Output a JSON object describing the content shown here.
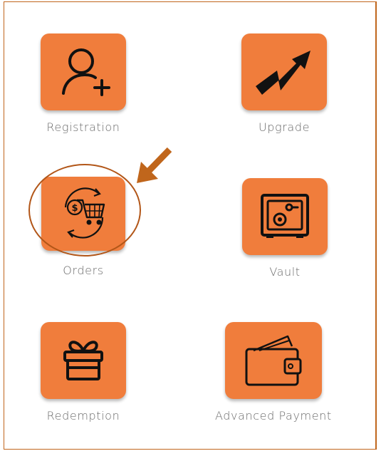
{
  "colors": {
    "accent": "#f07d3c",
    "annotation": "#c0661c",
    "label": "#6a6a6a"
  },
  "tiles": [
    {
      "id": "registration",
      "label": "Registration",
      "icon": "user-add-icon"
    },
    {
      "id": "upgrade",
      "label": "Upgrade",
      "icon": "trend-arrow-icon"
    },
    {
      "id": "orders",
      "label": "Orders",
      "icon": "cart-cycle-icon",
      "highlighted": true
    },
    {
      "id": "vault",
      "label": "Vault",
      "icon": "safe-icon"
    },
    {
      "id": "redemption",
      "label": "Redemption",
      "icon": "gift-icon"
    },
    {
      "id": "advanced_payment",
      "label": "Advanced Payment",
      "icon": "wallet-icon"
    }
  ],
  "annotation": {
    "target": "Orders",
    "shapes": [
      "circle",
      "arrow"
    ]
  }
}
